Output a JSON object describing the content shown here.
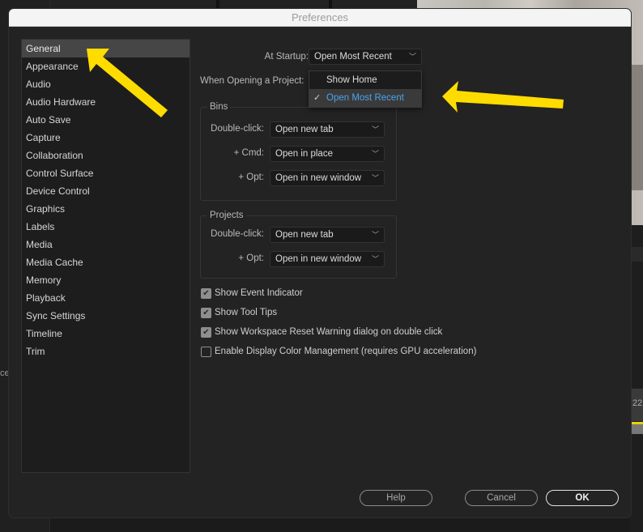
{
  "window": {
    "title": "Preferences"
  },
  "sidebar": {
    "selected": "General",
    "items": [
      {
        "label": "General"
      },
      {
        "label": "Appearance"
      },
      {
        "label": "Audio"
      },
      {
        "label": "Audio Hardware"
      },
      {
        "label": "Auto Save"
      },
      {
        "label": "Capture"
      },
      {
        "label": "Collaboration"
      },
      {
        "label": "Control Surface"
      },
      {
        "label": "Device Control"
      },
      {
        "label": "Graphics"
      },
      {
        "label": "Labels"
      },
      {
        "label": "Media"
      },
      {
        "label": "Media Cache"
      },
      {
        "label": "Memory"
      },
      {
        "label": "Playback"
      },
      {
        "label": "Sync Settings"
      },
      {
        "label": "Timeline"
      },
      {
        "label": "Trim"
      }
    ]
  },
  "general": {
    "at_startup_label": "At Startup:",
    "at_startup_value": "Open Most Recent",
    "startup_menu": {
      "options": [
        {
          "label": "Show Home",
          "checked": false
        },
        {
          "label": "Open Most Recent",
          "checked": true
        }
      ],
      "check_glyph": "✓"
    },
    "when_opening_label": "When Opening a Project:",
    "bins": {
      "title": "Bins",
      "double_click_label": "Double-click:",
      "double_click_value": "Open new tab",
      "cmd_label": "+ Cmd:",
      "cmd_value": "Open in place",
      "opt_label": "+ Opt:",
      "opt_value": "Open in new window"
    },
    "projects": {
      "title": "Projects",
      "double_click_label": "Double-click:",
      "double_click_value": "Open new tab",
      "opt_label": "+ Opt:",
      "opt_value": "Open in new window"
    },
    "checkboxes": [
      {
        "label": "Show Event Indicator",
        "checked": true
      },
      {
        "label": "Show Tool Tips",
        "checked": true
      },
      {
        "label": "Show Workspace Reset Warning dialog on double click",
        "checked": true
      },
      {
        "label": "Enable Display Color Management (requires GPU acceleration)",
        "checked": false
      }
    ],
    "check_glyph": "✔"
  },
  "footer": {
    "help": "Help",
    "cancel": "Cancel",
    "ok": "OK"
  },
  "icons": {
    "chevron": "﹀"
  },
  "background": {
    "timecode_fragment": ":22",
    "left_fragment": "ce"
  },
  "colors": {
    "accent_blue": "#4aa3ef",
    "annotation_yellow": "#ffdc00"
  }
}
